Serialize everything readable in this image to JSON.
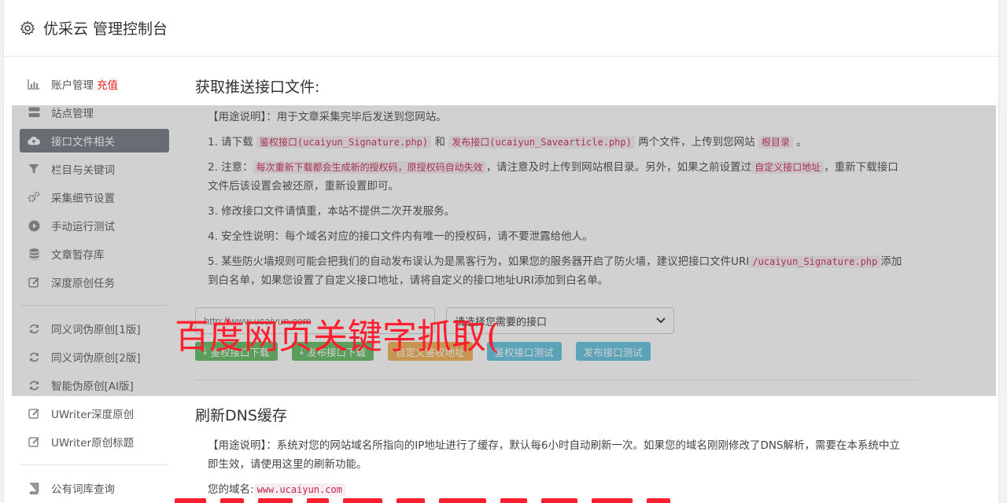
{
  "header": {
    "title": "优采云 管理控制台"
  },
  "sidebar": {
    "items": [
      {
        "label": "账户管理",
        "icon": "bar-chart-icon",
        "badge": "充值"
      },
      {
        "label": "站点管理",
        "icon": "server-icon"
      },
      {
        "label": "接口文件相关",
        "icon": "cloud-upload-icon",
        "active": true
      },
      {
        "label": "栏目与关键词",
        "icon": "filter-icon"
      },
      {
        "label": "采集细节设置",
        "icon": "gears-icon"
      },
      {
        "label": "手动运行测试",
        "icon": "play-circle-icon"
      },
      {
        "label": "文章暂存库",
        "icon": "database-icon"
      },
      {
        "label": "深度原创任务",
        "icon": "edit-icon"
      },
      {
        "label": "同义词伪原创[1版]",
        "icon": "refresh-icon"
      },
      {
        "label": "同义词伪原创[2版]",
        "icon": "refresh-icon"
      },
      {
        "label": "智能伪原创[AI版]",
        "icon": "refresh-icon"
      },
      {
        "label": "UWriter深度原创",
        "icon": "edit-icon"
      },
      {
        "label": "UWriter原创标题",
        "icon": "edit-icon"
      },
      {
        "label": "公有词库查询",
        "icon": "book-icon"
      }
    ]
  },
  "section1": {
    "title": "获取推送接口文件:",
    "usage": "【用途说明】：用于文章采集完毕后发送到您网站。",
    "p1": {
      "a": "1. 请下载",
      "c1": "鉴权接口(ucaiyun_Signature.php)",
      "b": "和",
      "c2": "发布接口(ucaiyun_Savearticle.php)",
      "c": "两个文件，上传到您网站",
      "c3": "根目录",
      "d": "。"
    },
    "p2": {
      "a": "2. 注意：",
      "c1": "每次重新下载都会生成新的授权码，原授权码自动失效",
      "b": "，请注意及时上传到网站根目录。另外，如果之前设置过",
      "c2": "自定义接口地址",
      "c": "，重新下载接口文件后该设置会被还原，重新设置即可。"
    },
    "p3": "3. 修改接口文件请慎重，本站不提供二次开发服务。",
    "p4": "4. 安全性说明：每个域名对应的接口文件内有唯一的授权码，请不要泄露给他人。",
    "p5": {
      "a": "5. 某些防火墙规则可能会把我们的自动发布误认为是黑客行为，如果您的服务器开启了防火墙，建议把接口文件URI",
      "c1": "/ucaiyun_Signature.php",
      "b": "添加到白名单，如果您设置了自定义接口地址，请将自定义的接口地址URI添加到白名单。"
    },
    "url_placeholder": "http://www.ucaiyun.com",
    "select_value": "请选择您需要的接口",
    "buttons": [
      "鉴权接口下载",
      "发布接口下载",
      "自定义鉴权地址",
      "鉴权接口测试",
      "发布接口测试"
    ]
  },
  "section2": {
    "title": "刷新DNS缓存",
    "usage": "【用途说明】：系统对您的网站域名所指向的IP地址进行了缓存，默认每6小时自动刷新一次。如果您的域名刚刚修改了DNS解析，需要在本系统中立即生效，请使用这里的刷新功能。",
    "domain_label": "您的域名:",
    "domain_value": "www.ucaiyun.com"
  },
  "overlay": {
    "text": "百度网页关键字抓取("
  },
  "colors": {
    "active_nav": "#6c757d",
    "btn_green": "#5cb85c",
    "btn_orange": "#f0ad4e",
    "btn_blue": "#5bc0de",
    "overlay_red": "#ff1e2d",
    "code_red": "#c7254e"
  }
}
